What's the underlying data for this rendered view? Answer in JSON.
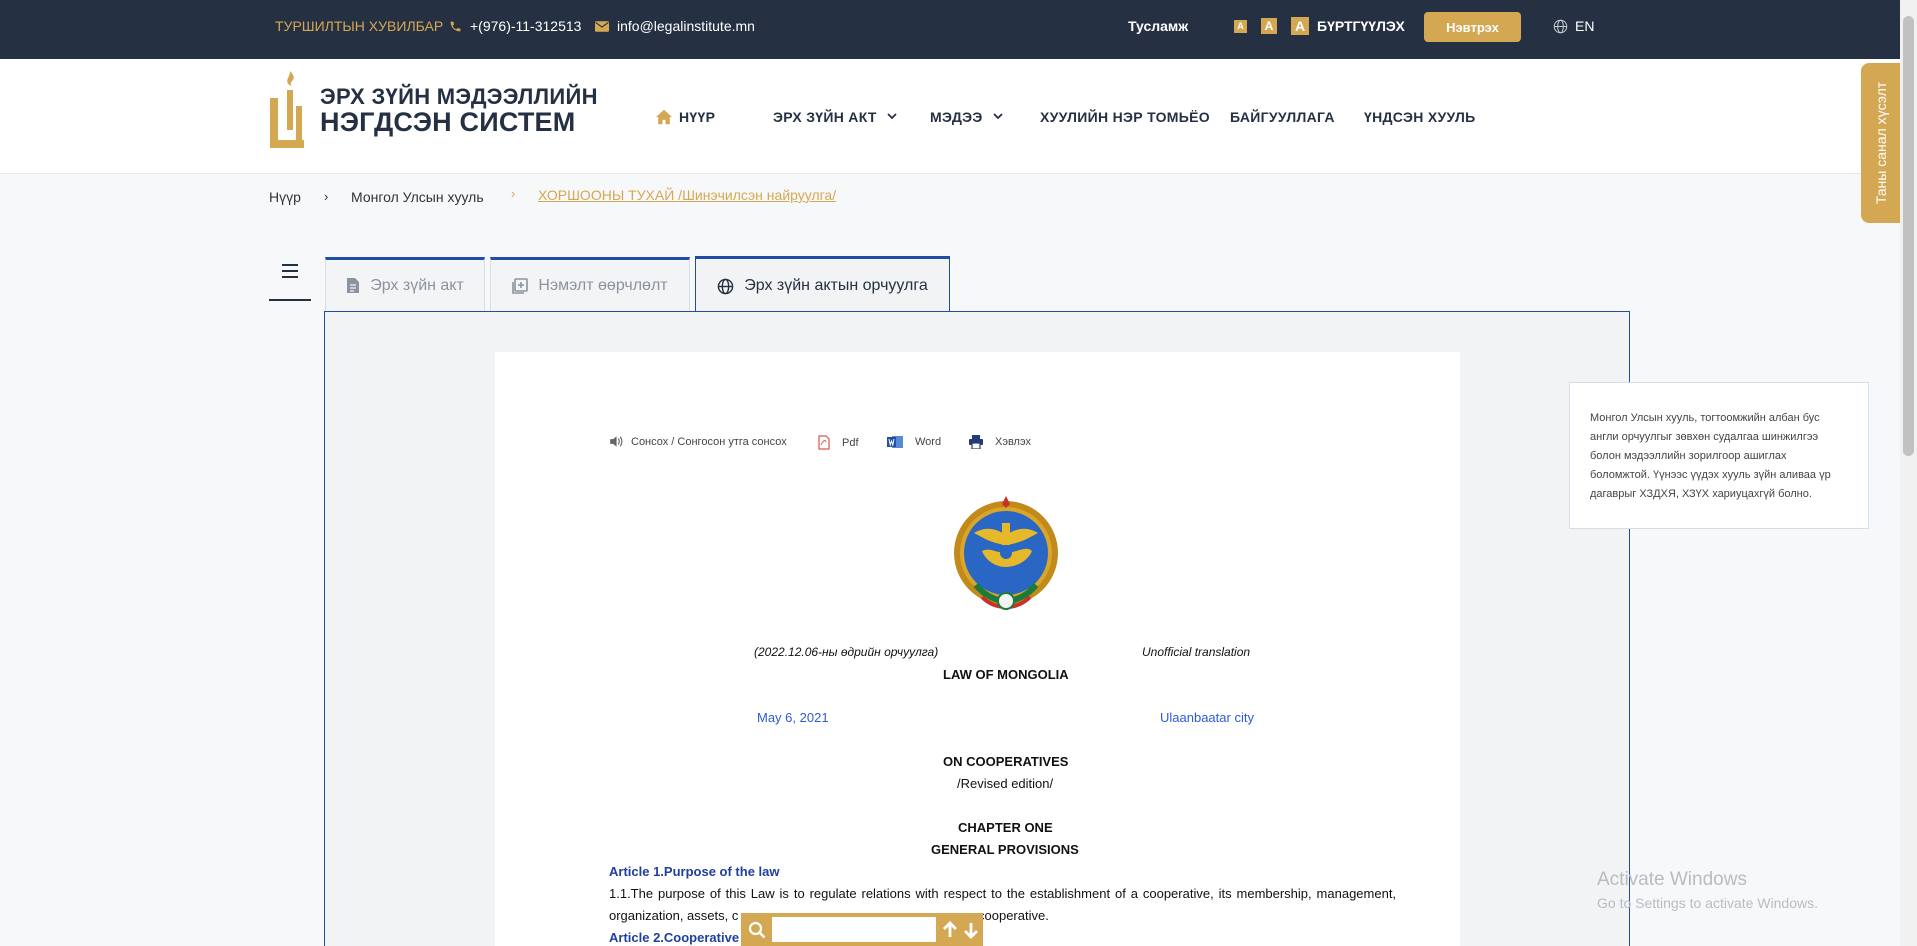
{
  "topbar": {
    "beta": "ТУРШИЛТЫН ХУВИЛБАР",
    "phone": "+(976)-11-312513",
    "email": "info@legalinstitute.mn",
    "help": "Тусламж",
    "font_sizes": [
      "A",
      "A",
      "A"
    ],
    "register": "БҮРТГҮҮЛЭХ",
    "login": "Нэвтрэх",
    "lang": "EN"
  },
  "logo": {
    "line1": "ЭРХ ЗҮЙН МЭДЭЭЛЛИЙН",
    "line2": "НЭГДСЭН СИСТЕМ"
  },
  "nav": {
    "home": "НҮҮР",
    "legal_acts": "ЭРХ ЗҮЙН АКТ",
    "news": "МЭДЭЭ",
    "glossary": "ХУУЛИЙН НЭР ТОМЬЁО",
    "organization": "БАЙГУУЛЛАГА",
    "constitution": "ҮНДСЭН ХУУЛЬ"
  },
  "breadcrumb": {
    "home": "Нүүр",
    "laws": "Монгол Улсын хууль",
    "current": "ХОРШООНЫ ТУХАЙ /Шинэчилсэн найруулга/",
    "sep": "›"
  },
  "feedback": "Таны санал хүсэлт",
  "tabs": {
    "legal_act": "Эрх зүйн акт",
    "amendments": "Нэмэлт өөрчлөлт",
    "translation": "Эрх зүйн актын орчуулга"
  },
  "toolbar": {
    "listen": "Сонсох / Сонгосон утга сонсох",
    "pdf": "Pdf",
    "word": "Word",
    "print": "Хэвлэх"
  },
  "document": {
    "translation_date": "(2022.12.06-ны өдрийн орчуулга)",
    "unofficial": "Unofficial translation",
    "law_of": "LAW OF MONGOLIA",
    "date": "May 6, 2021",
    "city": "Ulaanbaatar city",
    "title": "ON COOPERATIVES",
    "edition": "/Revised edition/",
    "chapter": "CHAPTER ONE",
    "chapter_title": "GENERAL PROVISIONS",
    "article1": "Article 1.Purpose of the law",
    "para1_line1": "1.1.The purpose of this Law is to regulate relations with respect to the establishment of a cooperative, its membership, management,",
    "para1_line2a": "organization, assets, c",
    "para1_line2b": "cooperative.",
    "article2": "Article 2.Cooperative"
  },
  "notice": "Монгол Улсын хууль, тогтоомжийн албан бус англи орчуулгыг зөвхөн судалгаа шинжилгээ болон мэдээллийн зорилгоор ашиглах боломжтой. Үүнээс үүдэх хууль зүйн аливаа үр дагаврыг ХЗДХЯ, ХЗҮХ хариуцахгүй болно.",
  "watermark": {
    "line1": "Activate Windows",
    "line2": "Go to Settings to activate Windows."
  },
  "colors": {
    "gold": "#d4a853",
    "navy": "#253143",
    "blue": "#1f4ea3"
  }
}
